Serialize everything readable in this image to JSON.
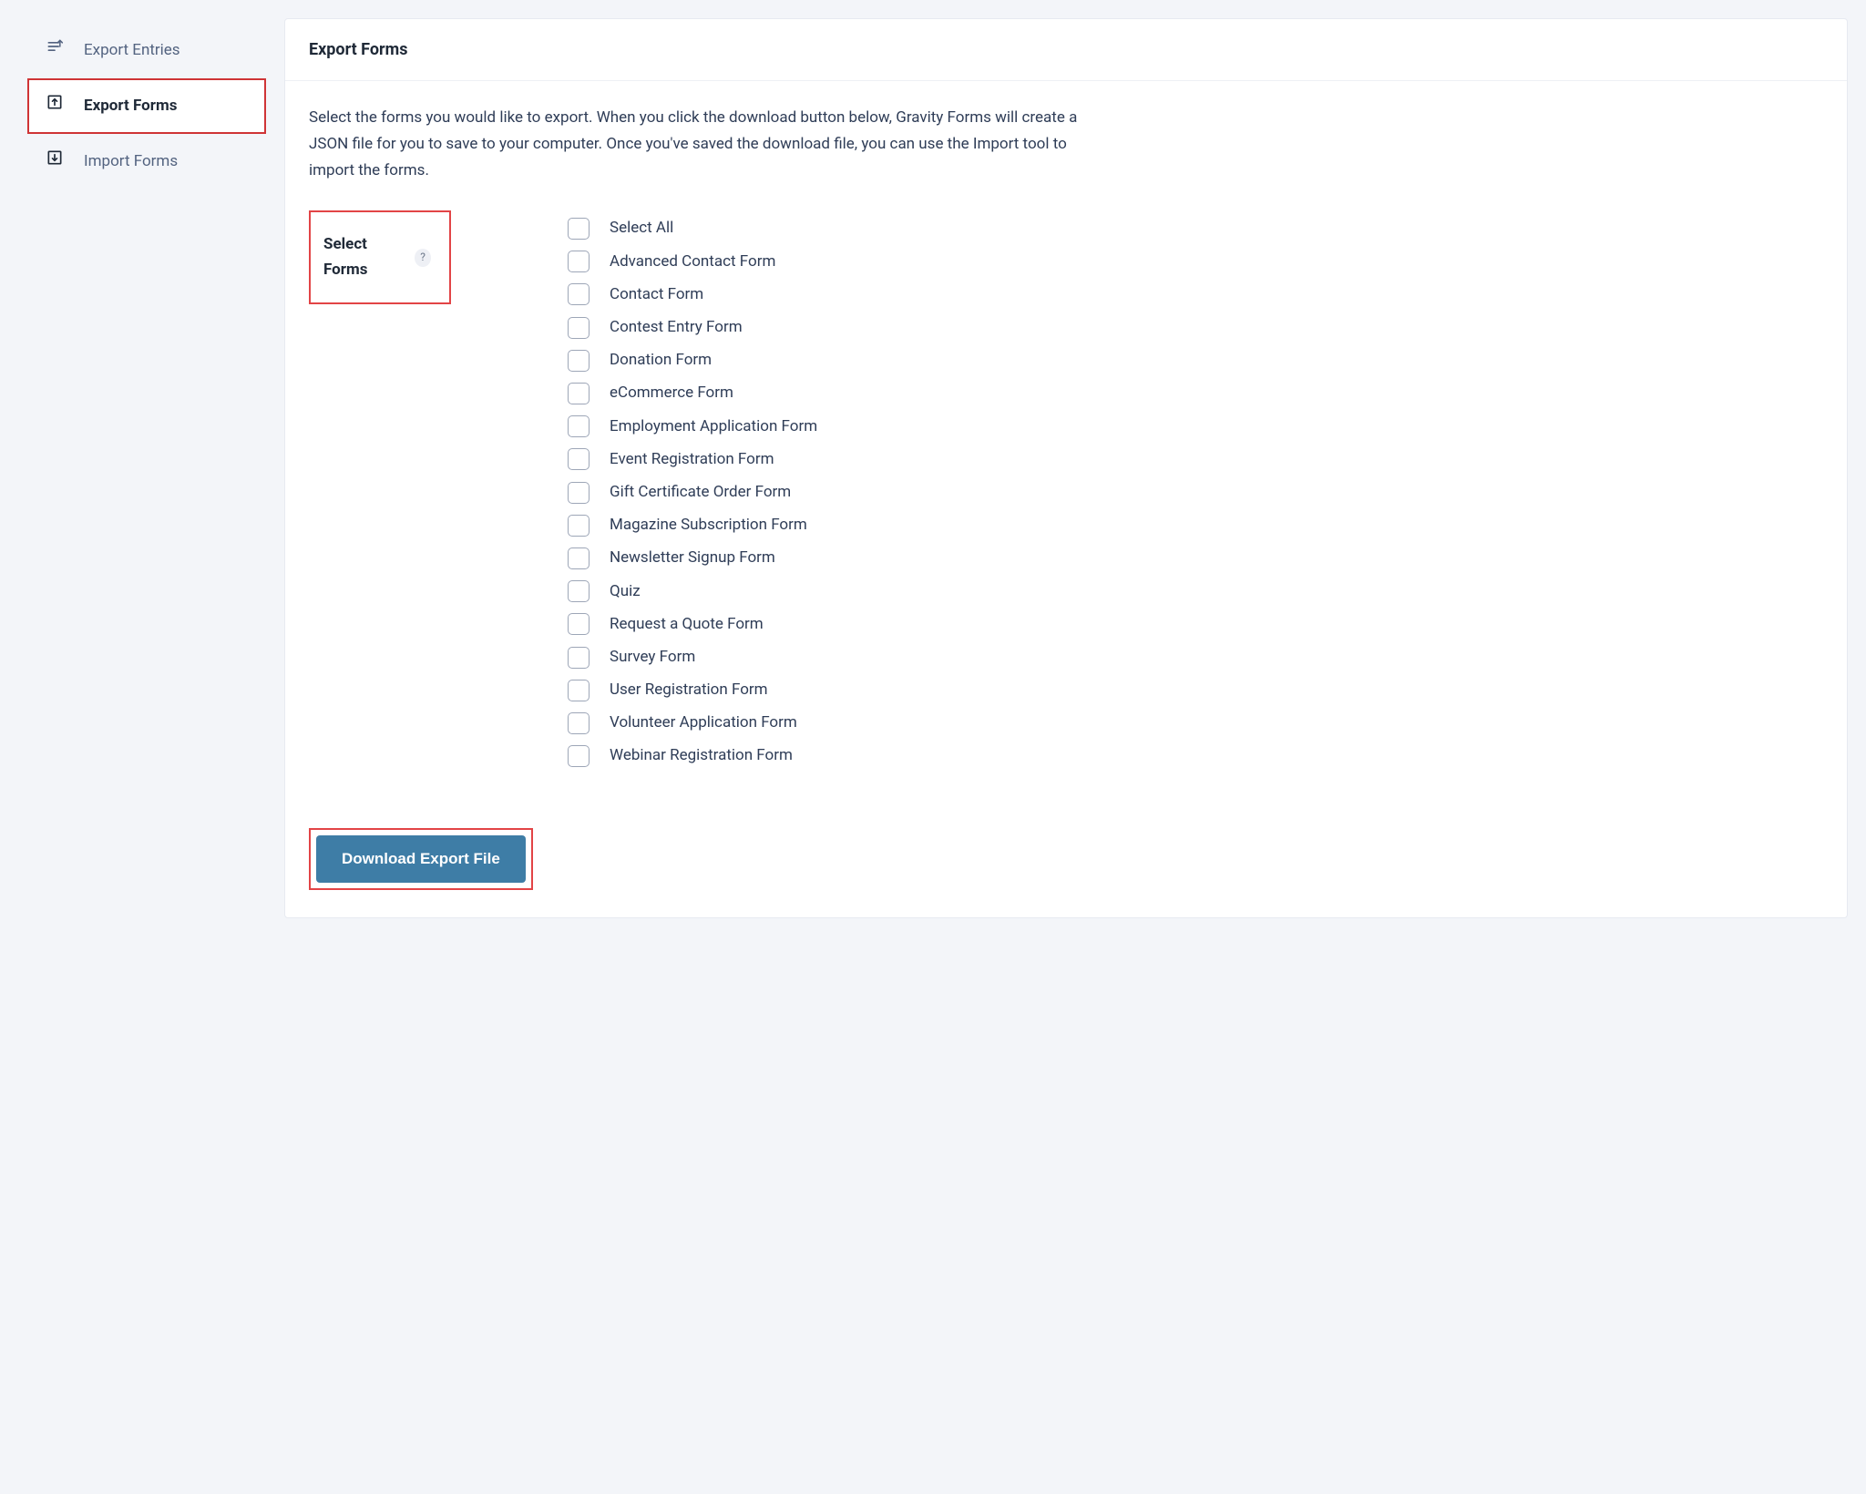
{
  "sidebar": {
    "items": [
      {
        "label": "Export Entries"
      },
      {
        "label": "Export Forms"
      },
      {
        "label": "Import Forms"
      }
    ]
  },
  "main": {
    "title": "Export Forms",
    "description": "Select the forms you would like to export. When you click the download button below, Gravity Forms will create a JSON file for you to save to your computer. Once you've saved the download file, you can use the Import tool to import the forms.",
    "field_label": "Select Forms",
    "help_symbol": "?",
    "select_all_label": "Select All",
    "forms": [
      "Advanced Contact Form",
      "Contact Form",
      "Contest Entry Form",
      "Donation Form",
      "eCommerce Form",
      "Employment Application Form",
      "Event Registration Form",
      "Gift Certificate Order Form",
      "Magazine Subscription Form",
      "Newsletter Signup Form",
      "Quiz",
      "Request a Quote Form",
      "Survey Form",
      "User Registration Form",
      "Volunteer Application Form",
      "Webinar Registration Form"
    ],
    "download_label": "Download Export File"
  }
}
